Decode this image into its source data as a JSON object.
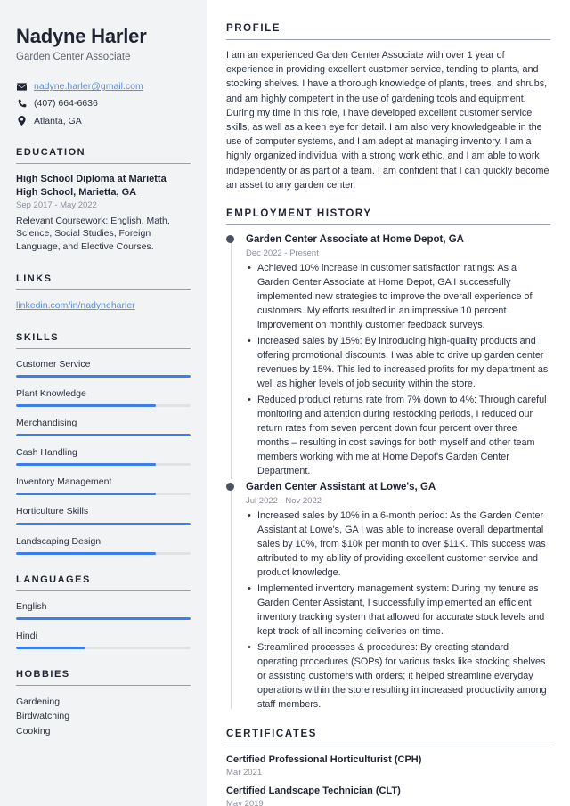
{
  "sidebar": {
    "name": "Nadyne Harler",
    "job_title": "Garden Center Associate",
    "contact": {
      "email": "nadyne.harler@gmail.com",
      "phone": "(407) 664-6636",
      "location": "Atlanta, GA"
    },
    "education": {
      "heading": "EDUCATION",
      "items": [
        {
          "degree": "High School Diploma at Marietta High School, Marietta, GA",
          "date": "Sep 2017 - May 2022",
          "description": "Relevant Coursework: English, Math, Science, Social Studies, Foreign Language, and Elective Courses."
        }
      ]
    },
    "links": {
      "heading": "LINKS",
      "items": [
        "linkedin.com/in/nadyneharler"
      ]
    },
    "skills": {
      "heading": "SKILLS",
      "items": [
        {
          "label": "Customer Service",
          "level": 100
        },
        {
          "label": "Plant Knowledge",
          "level": 80
        },
        {
          "label": "Merchandising",
          "level": 100
        },
        {
          "label": "Cash Handling",
          "level": 80
        },
        {
          "label": "Inventory Management",
          "level": 80
        },
        {
          "label": "Horticulture Skills",
          "level": 100
        },
        {
          "label": "Landscaping Design",
          "level": 80
        }
      ]
    },
    "languages": {
      "heading": "LANGUAGES",
      "items": [
        {
          "label": "English",
          "level": 100
        },
        {
          "label": "Hindi",
          "level": 40
        }
      ]
    },
    "hobbies": {
      "heading": "HOBBIES",
      "items": [
        "Gardening",
        "Birdwatching",
        "Cooking"
      ]
    }
  },
  "main": {
    "profile": {
      "heading": "PROFILE",
      "text": "I am an experienced Garden Center Associate with over 1 year of experience in providing excellent customer service, tending to plants, and stocking shelves. I have a thorough knowledge of plants, trees, and shrubs, and am highly competent in the use of gardening tools and equipment. During my time in this role, I have developed excellent customer service skills, as well as a keen eye for detail. I am also very knowledgeable in the use of computer systems, and I am adept at managing inventory. I am a highly organized individual with a strong work ethic, and I am able to work independently or as part of a team. I am confident that I can quickly become an asset to any garden center."
    },
    "employment": {
      "heading": "EMPLOYMENT HISTORY",
      "jobs": [
        {
          "role": "Garden Center Associate at Home Depot, GA",
          "date": "Dec 2022 - Present",
          "bullets": [
            "Achieved 10% increase in customer satisfaction ratings: As a Garden Center Associate at Home Depot, GA I successfully implemented new strategies to improve the overall experience of customers. My efforts resulted in an impressive 10 percent improvement on monthly customer feedback surveys.",
            "Increased sales by 15%: By introducing high-quality products and offering promotional discounts, I was able to drive up garden center revenues by 15%. This led to increased profits for my department as well as higher levels of job security within the store.",
            "Reduced product returns rate from 7% down to 4%: Through careful monitoring and attention during restocking periods, I reduced our return rates from seven percent down four percent over three months – resulting in cost savings for both myself and other team members working with me at Home Depot's Garden Center Department."
          ]
        },
        {
          "role": "Garden Center Assistant at Lowe's, GA",
          "date": "Jul 2022 - Nov 2022",
          "bullets": [
            "Increased sales by 10% in a 6-month period: As the Garden Center Assistant at Lowe's, GA I was able to increase overall departmental sales by 10%, from $10k per month to over $11K. This success was attributed to my ability of providing excellent customer service and product knowledge.",
            "Implemented inventory management system: During my tenure as Garden Center Assistant, I successfully implemented an efficient inventory tracking system that allowed for accurate stock levels and kept track of all incoming deliveries on time.",
            "Streamlined processes & procedures: By creating standard operating procedures (SOPs) for various tasks like stocking shelves or assisting customers with orders; it helped streamline everyday operations within the store resulting in increased productivity among staff members."
          ]
        }
      ]
    },
    "certificates": {
      "heading": "CERTIFICATES",
      "items": [
        {
          "name": "Certified Professional Horticulturist (CPH)",
          "date": "Mar 2021"
        },
        {
          "name": "Certified Landscape Technician (CLT)",
          "date": "May 2019"
        }
      ]
    }
  },
  "colors": {
    "accent": "#3b7ef0",
    "link": "#5b8dd9",
    "sidebar_bg": "#f2f3f5",
    "heading": "#1f2430",
    "muted": "#8b9099"
  }
}
